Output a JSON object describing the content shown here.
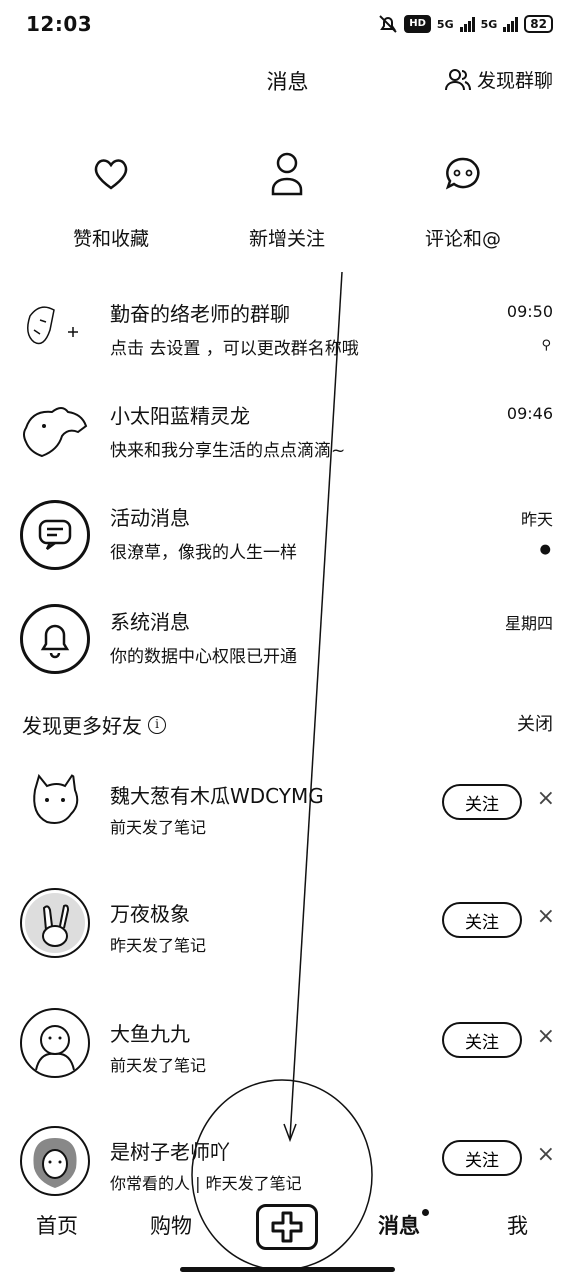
{
  "status_bar": {
    "time": "12:03",
    "hd": "HD",
    "net1": "5G",
    "net2": "5G",
    "battery": "82"
  },
  "header": {
    "title": "消息",
    "discover_group": "发现群聊"
  },
  "quick_actions": [
    {
      "label": "赞和收藏",
      "icon": "heart-icon"
    },
    {
      "label": "新增关注",
      "icon": "person-icon"
    },
    {
      "label": "评论和@",
      "icon": "comment-icon"
    }
  ],
  "conversations": [
    {
      "name": "勤奋的络老师的群聊",
      "preview": "点击 去设置 ，可以更改群名称哦",
      "time": "09:50",
      "extra": "⚲"
    },
    {
      "name": "小太阳蓝精灵龙",
      "preview": "快来和我分享生活的点点滴滴~",
      "time": "09:46",
      "extra": ""
    },
    {
      "name": "活动消息",
      "preview": "很潦草，像我的人生一样",
      "time": "昨天",
      "extra": "●"
    },
    {
      "name": "系统消息",
      "preview": "你的数据中心权限已开通",
      "time": "星期四",
      "extra": ""
    }
  ],
  "discover": {
    "title": "发现更多好友",
    "close": "关闭",
    "suggestions": [
      {
        "name": "魏大葱有木瓜WDCYMG",
        "sub": "前天发了笔记",
        "follow": "关注"
      },
      {
        "name": "万夜极象",
        "sub": "昨天发了笔记",
        "follow": "关注"
      },
      {
        "name": "大鱼九九",
        "sub": "前天发了笔记",
        "follow": "关注"
      },
      {
        "name": "是树子老师吖",
        "sub": "你常看的人 | 昨天发了笔记",
        "follow": "关注"
      }
    ]
  },
  "tabbar": {
    "home": "首页",
    "shop": "购物",
    "messages": "消息",
    "me": "我"
  }
}
